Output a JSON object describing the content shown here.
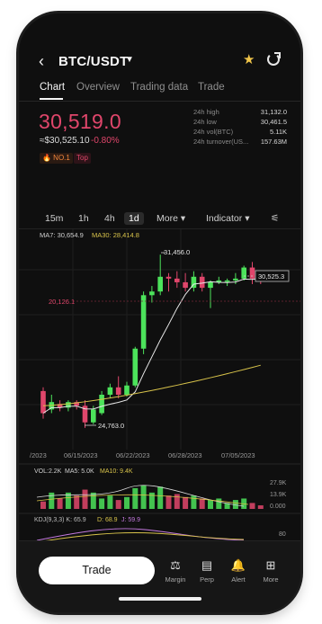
{
  "header": {
    "pair": "BTC/USDT"
  },
  "tabs": [
    {
      "label": "Chart",
      "active": true
    },
    {
      "label": "Overview",
      "active": false
    },
    {
      "label": "Trading data",
      "active": false
    },
    {
      "label": "Trade",
      "active": false
    }
  ],
  "price": {
    "last": "30,519.0",
    "usd": "≈$30,525.10",
    "change": "-0.80%",
    "badge_rank": "🔥 NO.1",
    "badge_top": "Top"
  },
  "stats": [
    {
      "label": "24h high",
      "value": "31,132.0"
    },
    {
      "label": "24h low",
      "value": "30,461.5"
    },
    {
      "label": "24h vol(BTC)",
      "value": "5.11K"
    },
    {
      "label": "24h turnover(US...",
      "value": "157.63M"
    }
  ],
  "intervals": {
    "items": [
      "15m",
      "1h",
      "4h",
      "1d"
    ],
    "selected": "1d",
    "more": "More",
    "indicator": "Indicator"
  },
  "chart_data": {
    "type": "candlestick",
    "ma_labels": {
      "ma7": "MA7: 30,654.9",
      "ma30": "MA30: 28,414.8"
    },
    "annotations": {
      "high": "31,456.0",
      "low": "24,763.0",
      "last_tag": "30,525.3",
      "level": "20,126.1"
    },
    "x_labels": [
      "/2023",
      "06/15/2023",
      "06/22/2023",
      "06/28/2023",
      "07/05/2023"
    ],
    "candles": [
      {
        "o": 0.22,
        "c": 0.1,
        "h": 0.24,
        "l": 0.07
      },
      {
        "o": 0.12,
        "c": 0.16,
        "h": 0.2,
        "l": 0.1
      },
      {
        "o": 0.15,
        "c": 0.13,
        "h": 0.17,
        "l": 0.11
      },
      {
        "o": 0.13,
        "c": 0.16,
        "h": 0.17,
        "l": 0.11
      },
      {
        "o": 0.16,
        "c": 0.14,
        "h": 0.17,
        "l": 0.12
      },
      {
        "o": 0.14,
        "c": 0.05,
        "h": 0.17,
        "l": 0.02
      },
      {
        "o": 0.05,
        "c": 0.12,
        "h": 0.14,
        "l": 0.04
      },
      {
        "o": 0.1,
        "c": 0.2,
        "h": 0.22,
        "l": 0.09
      },
      {
        "o": 0.2,
        "c": 0.24,
        "h": 0.26,
        "l": 0.18
      },
      {
        "o": 0.24,
        "c": 0.2,
        "h": 0.3,
        "l": 0.18
      },
      {
        "o": 0.2,
        "c": 0.25,
        "h": 0.27,
        "l": 0.19
      },
      {
        "o": 0.25,
        "c": 0.45,
        "h": 0.46,
        "l": 0.24
      },
      {
        "o": 0.45,
        "c": 0.74,
        "h": 0.76,
        "l": 0.42
      },
      {
        "o": 0.74,
        "c": 0.76,
        "h": 0.79,
        "l": 0.7
      },
      {
        "o": 0.76,
        "c": 0.84,
        "h": 0.96,
        "l": 0.74
      },
      {
        "o": 0.84,
        "c": 0.83,
        "h": 0.86,
        "l": 0.76
      },
      {
        "o": 0.83,
        "c": 0.81,
        "h": 0.87,
        "l": 0.78
      },
      {
        "o": 0.81,
        "c": 0.78,
        "h": 0.86,
        "l": 0.76
      },
      {
        "o": 0.78,
        "c": 0.84,
        "h": 0.87,
        "l": 0.76
      },
      {
        "o": 0.84,
        "c": 0.78,
        "h": 0.86,
        "l": 0.76
      },
      {
        "o": 0.78,
        "c": 0.81,
        "h": 0.82,
        "l": 0.67
      },
      {
        "o": 0.81,
        "c": 0.82,
        "h": 0.84,
        "l": 0.8
      },
      {
        "o": 0.82,
        "c": 0.82,
        "h": 0.83,
        "l": 0.79
      },
      {
        "o": 0.82,
        "c": 0.83,
        "h": 0.86,
        "l": 0.8
      },
      {
        "o": 0.83,
        "c": 0.89,
        "h": 0.9,
        "l": 0.82
      },
      {
        "o": 0.89,
        "c": 0.83,
        "h": 0.92,
        "l": 0.8
      },
      {
        "o": 0.83,
        "c": 0.82,
        "h": 0.86,
        "l": 0.8
      }
    ],
    "volume": {
      "labels": {
        "vol": "VOL:2.2K",
        "ma5": "MA5: 5.0K",
        "ma10": "MA10: 9.4K"
      },
      "axis": [
        "27.9K",
        "13.9K",
        "0.000"
      ],
      "values": [
        0.25,
        0.55,
        0.35,
        0.55,
        0.45,
        0.65,
        0.55,
        0.35,
        0.45,
        0.3,
        0.4,
        0.7,
        0.8,
        0.55,
        0.75,
        0.45,
        0.5,
        0.4,
        0.45,
        0.35,
        0.3,
        0.35,
        0.2,
        0.3,
        0.35,
        0.2,
        0.12
      ]
    },
    "kdj": {
      "labels": {
        "k": "KDJ(9,3,3) K: 65.9",
        "d": "D: 68.9",
        "j": "J: 59.9"
      },
      "axis": "80"
    }
  },
  "nav": [
    {
      "label": "Margin",
      "icon": "margin-icon",
      "glyph": "⚖"
    },
    {
      "label": "Perp",
      "icon": "perp-icon",
      "glyph": "▤"
    },
    {
      "label": "Alert",
      "icon": "alert-bell-icon",
      "glyph": "🔔"
    },
    {
      "label": "More",
      "icon": "grid-more-icon",
      "glyph": "⊞"
    }
  ],
  "trade_button": "Trade",
  "colors": {
    "up": "#4ce35b",
    "down": "#e0466b",
    "ma7": "#e8e8e8",
    "ma30": "#d7c24a"
  }
}
